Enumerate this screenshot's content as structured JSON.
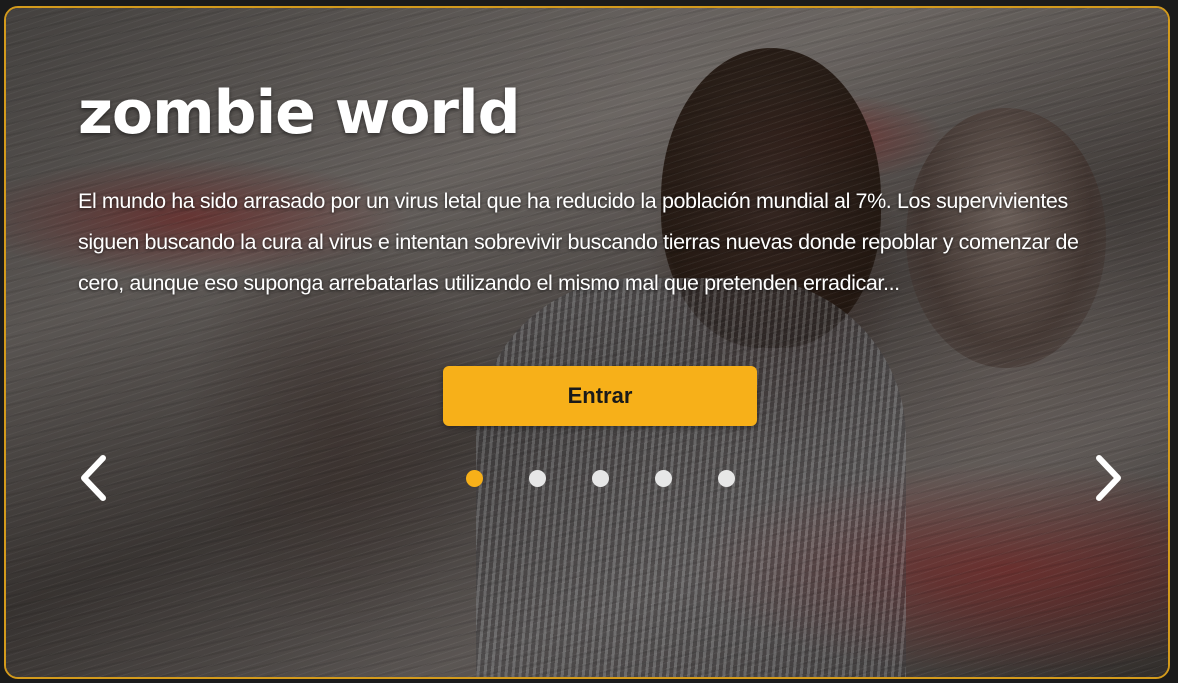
{
  "hero": {
    "title": "zombie world",
    "description": "El mundo ha sido arrasado por un virus letal que ha reducido la población mundial al 7%. Los supervivientes siguen buscando la cura al virus e intentan sobrevivir buscando tierras nuevas donde repoblar y comenzar de cero, aunque eso suponga arrebatarlas utilizando el mismo mal que pretenden erradicar...",
    "enter_label": "Entrar"
  },
  "carousel": {
    "prev_icon": "chevron-left-icon",
    "next_icon": "chevron-right-icon",
    "slide_count": 5,
    "active_index": 0
  },
  "colors": {
    "accent": "#f7b019",
    "frame_border": "#d39a1c",
    "dot_inactive": "#e7e7e7",
    "text": "#ffffff"
  }
}
